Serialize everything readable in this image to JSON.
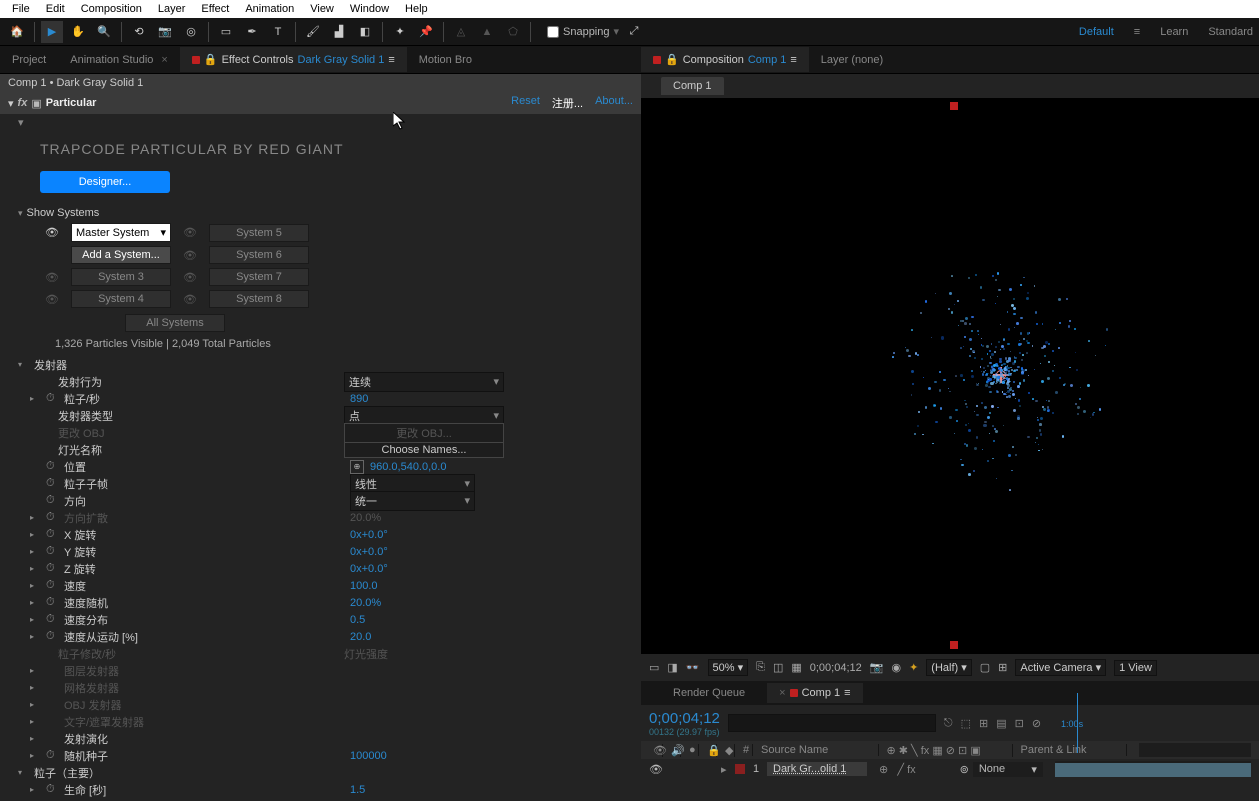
{
  "menu": {
    "file": "File",
    "edit": "Edit",
    "composition": "Composition",
    "layer": "Layer",
    "effect": "Effect",
    "animation": "Animation",
    "view": "View",
    "window": "Window",
    "help": "Help"
  },
  "toolbar": {
    "snapping": "Snapping"
  },
  "workspaces": {
    "default": "Default",
    "learn": "Learn",
    "standard": "Standard"
  },
  "leftTabs": {
    "project": "Project",
    "animStudio": "Animation Studio",
    "effectControls": "Effect Controls",
    "layerName": "Dark Gray Solid 1",
    "motionBro": "Motion Bro"
  },
  "breadcrumb": "Comp 1 • Dark Gray Solid 1",
  "fx": {
    "name": "Particular",
    "reset": "Reset",
    "register": "注册...",
    "about": "About..."
  },
  "trapcode": {
    "title": "TRAPCODE PARTICULAR BY RED GIANT",
    "designer": "Designer..."
  },
  "showSystems": "Show Systems",
  "systems": {
    "master": "Master System",
    "add": "Add a System...",
    "s3": "System 3",
    "s4": "System 4",
    "s5": "System 5",
    "s6": "System 6",
    "s7": "System 7",
    "s8": "System 8",
    "all": "All Systems"
  },
  "particleInfo": "1,326 Particles Visible  |  2,049 Total Particles",
  "emitter": {
    "header": "发射器",
    "behaviour": {
      "label": "发射行为",
      "value": "连续"
    },
    "particlesSec": {
      "label": "粒子/秒",
      "value": "890"
    },
    "emitterType": {
      "label": "发射器类型",
      "value": "点"
    },
    "changeObj": {
      "label": "更改 OBJ",
      "btn": "更改 OBJ..."
    },
    "lightName": {
      "label": "灯光名称",
      "btn": "Choose Names..."
    },
    "position": {
      "label": "位置",
      "value": "960.0,540.0,0.0"
    },
    "subframe": {
      "label": "粒子子帧",
      "value": "线性"
    },
    "direction": {
      "label": "方向",
      "value": "统一"
    },
    "dirSpread": {
      "label": "方向扩散",
      "value": "20.0%"
    },
    "xrot": {
      "label": "X 旋转",
      "value": "0x+0.0°"
    },
    "yrot": {
      "label": "Y 旋转",
      "value": "0x+0.0°"
    },
    "zrot": {
      "label": "Z 旋转",
      "value": "0x+0.0°"
    },
    "velocity": {
      "label": "速度",
      "value": "100.0"
    },
    "velRandom": {
      "label": "速度随机",
      "value": "20.0%"
    },
    "velDist": {
      "label": "速度分布",
      "value": "0.5"
    },
    "velMotion": {
      "label": "速度从运动 [%]",
      "value": "20.0"
    },
    "modSec": {
      "label": "粒子修改/秒",
      "value": "灯光强度"
    },
    "layerEmitter": "图层发射器",
    "gridEmitter": "网格发射器",
    "objEmitter": "OBJ 发射器",
    "textEmitter": "文字/遮罩发射器",
    "emission": "发射演化",
    "seed": {
      "label": "随机种子",
      "value": "100000"
    }
  },
  "particle": {
    "header": "粒子（主要）",
    "life": {
      "label": "生命 [秒]",
      "value": "1.5"
    }
  },
  "rightTabs": {
    "composition": "Composition",
    "compName": "Comp 1",
    "layer": "Layer  (none)"
  },
  "compTab": "Comp 1",
  "viewerBar": {
    "zoom": "50%",
    "time": "0;00;04;12",
    "res": "(Half)",
    "camera": "Active Camera",
    "view": "1 View"
  },
  "tlTabs": {
    "renderQueue": "Render Queue",
    "comp": "Comp 1"
  },
  "timeline": {
    "time": "0;00;04;12",
    "frames": "00132 (29.97 fps)",
    "search": "",
    "colSource": "Source Name",
    "colParent": "Parent & Link",
    "rowNum": "1",
    "rowName": "Dark Gr...olid 1",
    "parentVal": "None",
    "rulerStart": "1:00s"
  }
}
